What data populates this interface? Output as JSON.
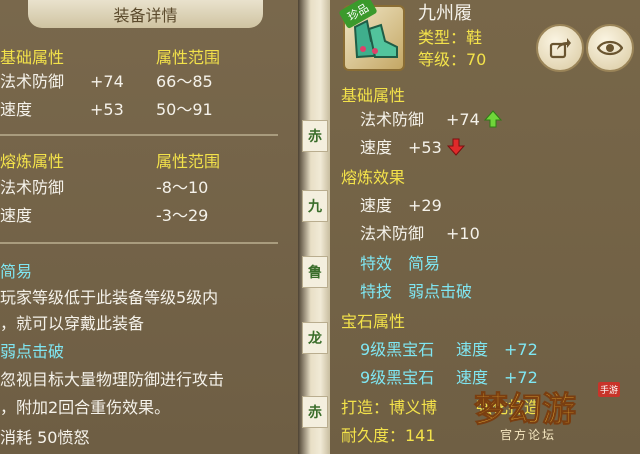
{
  "left": {
    "title": "装备详情",
    "base_header": "基础属性",
    "range_header": "属性范围",
    "base_rows": [
      {
        "name": "法术防御",
        "value": "+74",
        "range": "66～85"
      },
      {
        "name": "速度",
        "value": "+53",
        "range": "50～91"
      }
    ],
    "refine_header": "熔炼属性",
    "refine_range_header": "属性范围",
    "refine_rows": [
      {
        "name": "法术防御",
        "range": "-8～10"
      },
      {
        "name": "速度",
        "range": "-3～29"
      }
    ],
    "skill1_title": "简易",
    "skill1_desc_1": "玩家等级低于此装备等级5级内",
    "skill1_desc_2": "，就可以穿戴此装备",
    "skill2_title": "弱点击破",
    "skill2_desc_1": "忽视目标大量物理防御进行攻击",
    "skill2_desc_2": "，附加2回合重伤效果。",
    "cost": "消耗  50愤怒"
  },
  "strip": {
    "tabs": [
      "赤",
      "九",
      "鲁",
      "龙",
      "赤"
    ]
  },
  "right": {
    "badge": "珍品",
    "item_name": "九州履",
    "type_line": "类型：鞋",
    "level_line": "等级：70",
    "base_header": "基础属性",
    "base_rows": [
      {
        "name": "法术防御",
        "value": "+74",
        "trend": "up"
      },
      {
        "name": "速度",
        "value": "+53",
        "trend": "down"
      }
    ],
    "refine_header": "熔炼效果",
    "refine_rows": [
      {
        "name": "速度",
        "value": "+29"
      },
      {
        "name": "法术防御",
        "value": "+10"
      }
    ],
    "effect_label": "特效",
    "effect_value": "简易",
    "skill_label": "特技",
    "skill_value": "弱点击破",
    "gem_header": "宝石属性",
    "gem_rows": [
      {
        "gem": "9级黑宝石",
        "attr": "速度",
        "value": "+72"
      },
      {
        "gem": "9级黑宝石",
        "attr": "速度",
        "value": "+72"
      }
    ],
    "forge_line": "打造：博义博",
    "enhance_line": "强化打造",
    "durability_line": "耐久度：141"
  },
  "watermark": {
    "brand": "梦幻游",
    "sub": "官方论坛",
    "tag": "手游"
  },
  "colors": {
    "yellow": "#f3e24a",
    "cyan": "#7fe6f2",
    "up_arrow": "#6fd63a",
    "down_arrow": "#e02a2a"
  }
}
